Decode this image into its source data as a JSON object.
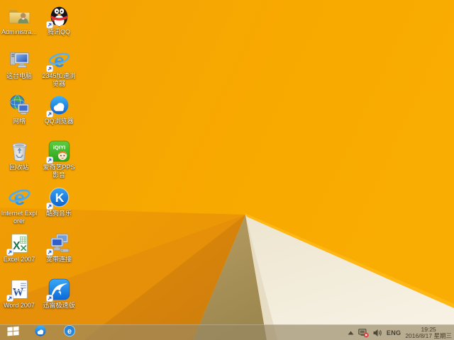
{
  "desktop": {
    "icons": [
      {
        "name": "administrator-folder",
        "label": "Administra...",
        "shortcut": false
      },
      {
        "name": "tencent-qq",
        "label": "腾讯QQ",
        "shortcut": true
      },
      {
        "name": "this-pc",
        "label": "这台电脑",
        "shortcut": false
      },
      {
        "name": "2345-browser",
        "label": "2345加速浏览器",
        "shortcut": true
      },
      {
        "name": "network",
        "label": "网络",
        "shortcut": false
      },
      {
        "name": "qq-browser",
        "label": "QQ浏览器",
        "shortcut": true
      },
      {
        "name": "recycle-bin",
        "label": "回收站",
        "shortcut": false
      },
      {
        "name": "iqiyi-pps",
        "label": "爱奇艺PPS 影音",
        "shortcut": true
      },
      {
        "name": "internet-explorer",
        "label": "Internet Explorer",
        "shortcut": false
      },
      {
        "name": "kugou-music",
        "label": "酷狗音乐",
        "shortcut": true
      },
      {
        "name": "excel-2007",
        "label": "Excel 2007",
        "shortcut": true
      },
      {
        "name": "broadband-connection",
        "label": "宽带连接",
        "shortcut": true
      },
      {
        "name": "word-2007",
        "label": "Word 2007",
        "shortcut": true
      },
      {
        "name": "thunder-speed",
        "label": "迅雷极速版",
        "shortcut": true
      }
    ]
  },
  "icon_glyphs": {
    "ie_letter": "e",
    "browser2345_letter": "e",
    "taskbar_2345_letter": "e",
    "kugou_letter": "K",
    "excel_letter": "X",
    "word_letter": "W",
    "iqiyi_text": "iQIYI"
  },
  "taskbar": {
    "icons": [
      "windows-start",
      "qq-browser",
      "2345-browser"
    ]
  },
  "tray": {
    "icons": [
      "show-hidden-icons",
      "network-disconnected",
      "volume"
    ],
    "language": "ENG",
    "time": "19:25",
    "date": "2016/8/17 星期三"
  },
  "colors": {
    "wallpaper_base": "#f7a600",
    "wallpaper_dark_facet": "#e59008",
    "wallpaper_tan": "#ab9258",
    "wallpaper_cream": "#f2ebd9",
    "wallpaper_highlight": "#ffb713",
    "taskbar": "#988965",
    "tray_text": "#463f2f"
  }
}
